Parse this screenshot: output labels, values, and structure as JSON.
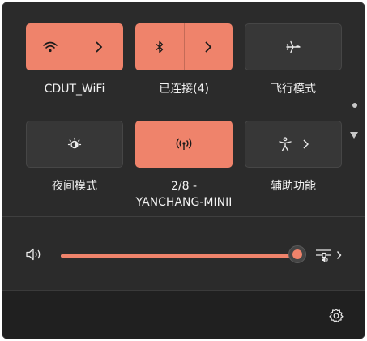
{
  "tiles": [
    {
      "label": "CDUT_WiFi",
      "icon": "wifi-icon",
      "state": "on",
      "split": true
    },
    {
      "label": "已连接(4)",
      "icon": "bluetooth-icon",
      "state": "on",
      "split": true
    },
    {
      "label": "飞行模式",
      "icon": "airplane-icon",
      "state": "off"
    },
    {
      "label": "夜间模式",
      "icon": "night-light-icon",
      "state": "off"
    },
    {
      "label": "2/8 -\nYANCHANG-MINII",
      "icon": "mobile-hotspot-icon",
      "state": "on"
    },
    {
      "label": "辅助功能",
      "icon": "accessibility-icon",
      "state": "off",
      "chevron": true
    }
  ],
  "volume": {
    "level": 1.0,
    "icon": "speaker-icon",
    "mixer_icon": "audio-output-icon"
  },
  "footer": {
    "settings_icon": "settings-gear-icon"
  },
  "colors": {
    "accent": "#ef836b",
    "panel": "#2b2b2b",
    "tile_off": "#373737",
    "footer": "#202020"
  }
}
